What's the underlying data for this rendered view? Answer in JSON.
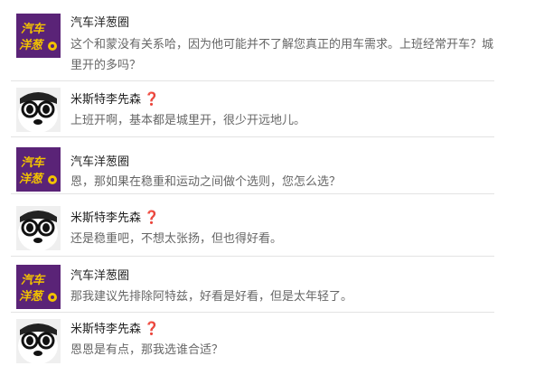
{
  "messages": [
    {
      "author": "汽车洋葱圈",
      "avatar": "brand-logo-icon",
      "text": "这个和蒙没有关系哈，因为他可能并不了解您真正的用车需求。上班经常开车？城里开的多吗？"
    },
    {
      "author": "米斯特李先森",
      "avatar": "panda-glasses-icon",
      "badge": "❓",
      "text": "上班开啊，基本都是城里开，很少开远地儿。"
    },
    {
      "author": "汽车洋葱圈",
      "avatar": "brand-logo-icon",
      "text": "恩，那如果在稳重和运动之间做个选则，您怎么选？"
    },
    {
      "author": "米斯特李先森",
      "avatar": "panda-glasses-icon",
      "badge": "❓",
      "text": "还是稳重吧，不想太张扬，但也得好看。"
    },
    {
      "author": "汽车洋葱圈",
      "avatar": "brand-logo-icon",
      "text": "那我建议先排除阿特兹，好看是好看，但是太年轻了。"
    },
    {
      "author": "米斯特李先森",
      "avatar": "panda-glasses-icon",
      "badge": "❓",
      "text": "恩恩是有点，那我选谁合适？"
    }
  ],
  "brand_logo": {
    "line1": "汽车",
    "line2": "洋葱"
  },
  "colors": {
    "brand_purple": "#5a2377",
    "brand_yellow": "#f2c200",
    "question_red": "#c0392b",
    "separator": "#e3e3e3"
  }
}
